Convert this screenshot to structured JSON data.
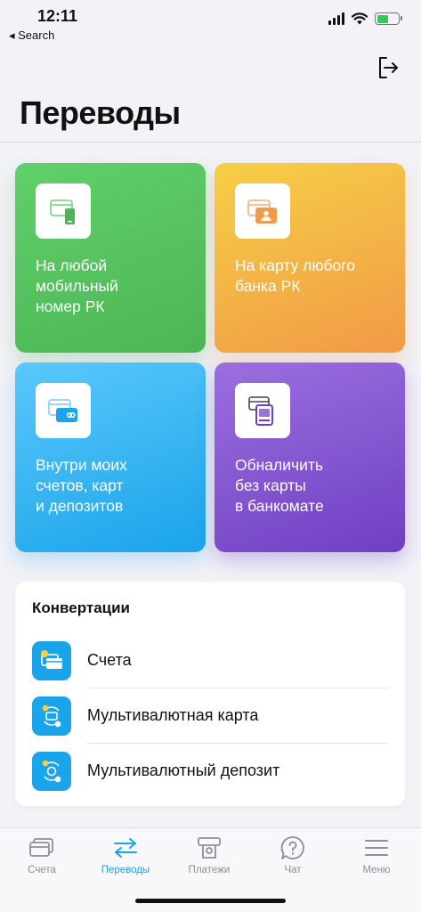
{
  "status_bar": {
    "time": "12:11",
    "back_label": "◂ Search"
  },
  "header": {
    "title": "Переводы"
  },
  "tiles": [
    {
      "label": "На любой\nмобильный\nномер РК",
      "icon": "phone-card-icon",
      "color": "#4db555"
    },
    {
      "label": "На карту любого\nбанка РК",
      "icon": "user-card-icon",
      "color": "#f19a47"
    },
    {
      "label": "Внутри моих\nсчетов, карт\nи депозитов",
      "icon": "own-cards-icon",
      "color": "#1aa4ea"
    },
    {
      "label": "Обналичить\nбез карты\nв банкомате",
      "icon": "atm-icon",
      "color": "#6f3fc2"
    }
  ],
  "conversions": {
    "title": "Конвертации",
    "items": [
      {
        "label": "Счета",
        "icon": "accounts-exchange-icon"
      },
      {
        "label": "Мультивалютная карта",
        "icon": "multicurrency-card-icon"
      },
      {
        "label": "Мультивалютный депозит",
        "icon": "multicurrency-deposit-icon"
      }
    ]
  },
  "tab_bar": {
    "items": [
      {
        "label": "Счета",
        "icon": "cards-icon",
        "active": false
      },
      {
        "label": "Переводы",
        "icon": "transfer-arrows-icon",
        "active": true
      },
      {
        "label": "Платежи",
        "icon": "payment-terminal-icon",
        "active": false
      },
      {
        "label": "Чат",
        "icon": "chat-question-icon",
        "active": false
      },
      {
        "label": "Меню",
        "icon": "menu-icon",
        "active": false
      }
    ]
  },
  "colors": {
    "accent": "#1aa4ea",
    "background": "#f2f2f7"
  }
}
